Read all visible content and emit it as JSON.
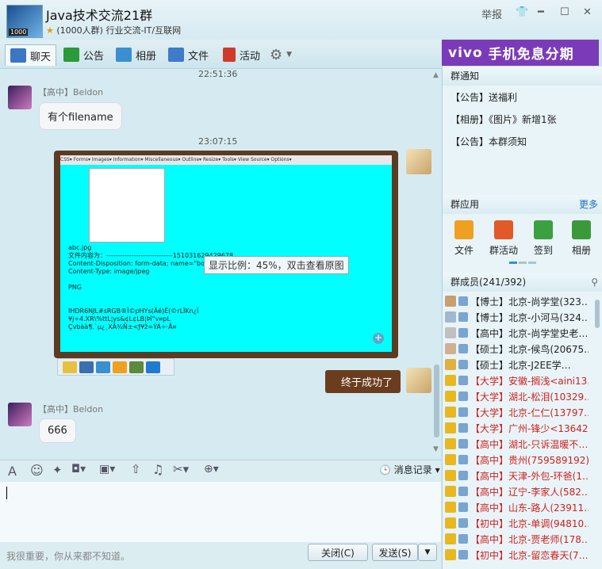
{
  "window": {
    "title": "Java技术交流21群",
    "subtitle": "(1000人群) 行业交流-IT/互联网",
    "avatar_badge": "1000",
    "report_label": "举报"
  },
  "tabs": [
    {
      "label": "聊天",
      "color": "#3a77c0"
    },
    {
      "label": "公告",
      "color": "#2a9a3a"
    },
    {
      "label": "相册",
      "color": "#3a8fd0"
    },
    {
      "label": "文件",
      "color": "#3d7cc9"
    },
    {
      "label": "活动",
      "color": "#d03a2a"
    }
  ],
  "ad": {
    "brand": "vivo",
    "text": "手机免息分期"
  },
  "messages": [
    {
      "time": "22:51:36",
      "sender": "【高中】Beldon",
      "text": "有个filename"
    },
    {
      "time": "23:07:15"
    },
    {
      "zoom_tip": "显示比例：45%，双击查看原图",
      "my_text": "终于成功了"
    },
    {
      "sender": "【高中】Beldon",
      "text": "666"
    }
  ],
  "screenshot_content": {
    "toolbar": "CSS▾  Forms▾  Images▾  Information▾  Miscellaneous▾  Outline▾  Resize▾  Tools▾  View Source▾  Options▾",
    "lines": "abc.jpg\n文件内容为：-----------------------------151031629429678\nContent-Disposition: form-data; name=\"boy\"; filename=\"abc.jpg\"\nContent-Type: image/jpeg\n\nPNG\n\n\nIHDR6NJL#sRGB®Î©pHYs(Ãé)Ë(©rLÏKn¿Ï\n¥j÷4.XR\\%ttL¦ys&¢L¢LB¦Þî\"v¤pL\nÇvbàà¶.`µ¿¸XÂ¾Ñ±<ƒ¥ž=ÝÁ÷·Å¤"
  },
  "input": {
    "history_label": "消息记录",
    "status_text": "我很重要，你从来都不知道。",
    "close_label": "关闭(C)",
    "send_label": "发送(S)"
  },
  "right_panel": {
    "notice_title": "群通知",
    "notices": [
      "【公告】送福利",
      "【相册】《图片》新增1张",
      "【公告】本群须知"
    ],
    "apps_title": "群应用",
    "apps_more": "更多",
    "apps": [
      {
        "label": "文件",
        "color": "#f0a020"
      },
      {
        "label": "群活动",
        "color": "#e05a2a"
      },
      {
        "label": "签到",
        "color": "#3aa040"
      },
      {
        "label": "相册",
        "color": "#3a9a3a"
      }
    ],
    "members_title": "群成员(241/392)",
    "members": [
      {
        "text": "【博士】北京-尚学堂(323…",
        "color": "#222"
      },
      {
        "text": "【博士】北京-小河马(324…",
        "color": "#222"
      },
      {
        "text": "【高中】北京-尚学堂史老…",
        "color": "#222"
      },
      {
        "text": "【硕士】北京-候鸟(20675…",
        "color": "#222"
      },
      {
        "text": "【硕士】北京-J2EE学…",
        "color": "#222"
      },
      {
        "text": "【大学】安徽-搁浅<aini13…",
        "color": "#d02020"
      },
      {
        "text": "【大学】湖北-松泪(10329…",
        "color": "#d02020"
      },
      {
        "text": "【大学】北京-仁仁(13797…",
        "color": "#d02020"
      },
      {
        "text": "【大学】广州-锋少<13642…",
        "color": "#d02020"
      },
      {
        "text": "【高中】湖北-只诉温暖不…",
        "color": "#d02020"
      },
      {
        "text": "【高中】贵州(759589192)",
        "color": "#d02020"
      },
      {
        "text": "【高中】天津-外包-环爸(1…",
        "color": "#d02020"
      },
      {
        "text": "【高中】辽宁-李家人(582…",
        "color": "#d02020"
      },
      {
        "text": "【高中】山东-路人(23911…",
        "color": "#d02020"
      },
      {
        "text": "【初中】北京-单调(94810…",
        "color": "#d02020"
      },
      {
        "text": "【高中】北京-贾老师(178…",
        "color": "#d02020"
      },
      {
        "text": "【初中】北京-留恋春天(7…",
        "color": "#d02020"
      }
    ]
  }
}
